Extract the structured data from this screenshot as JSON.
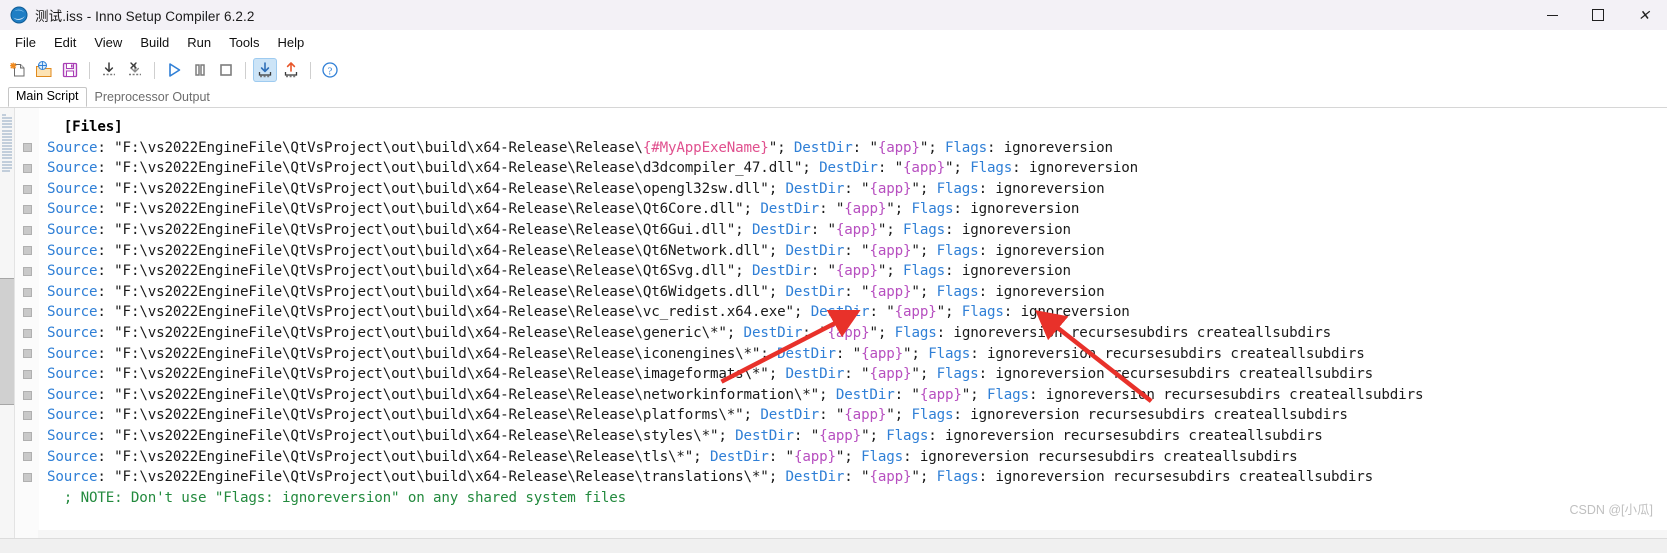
{
  "window": {
    "title": "测试.iss - Inno Setup Compiler 6.2.2",
    "app_icon": "inno-setup-icon",
    "controls": {
      "minimize": "—",
      "maximize": "☐",
      "close": "✕"
    }
  },
  "menubar": {
    "items": [
      {
        "label": "File"
      },
      {
        "label": "Edit"
      },
      {
        "label": "View"
      },
      {
        "label": "Build"
      },
      {
        "label": "Run"
      },
      {
        "label": "Tools"
      },
      {
        "label": "Help"
      }
    ]
  },
  "toolbar": {
    "buttons": [
      {
        "name": "new-file-icon",
        "tip": "New"
      },
      {
        "name": "open-file-icon",
        "tip": "Open"
      },
      {
        "name": "save-file-icon",
        "tip": "Save"
      },
      {
        "name": "compile-icon",
        "tip": "Compile"
      },
      {
        "name": "stop-compile-icon",
        "tip": "Stop Compile"
      },
      {
        "name": "run-icon",
        "tip": "Run"
      },
      {
        "name": "pause-icon",
        "tip": "Pause"
      },
      {
        "name": "terminate-icon",
        "tip": "Terminate"
      },
      {
        "name": "import-icon",
        "tip": "Target Setup File"
      },
      {
        "name": "export-icon",
        "tip": "Open Output Folder"
      },
      {
        "name": "help-icon",
        "tip": "Help"
      }
    ]
  },
  "tabs": [
    {
      "label": "Main Script",
      "selected": true
    },
    {
      "label": "Preprocessor Output",
      "selected": false
    }
  ],
  "editor": {
    "colors": {
      "keyword": "#2f7fd6",
      "constant": "#b74fc0",
      "preprocessor": "#e0508e",
      "comment": "#238a3e",
      "text": "#1a1a1a",
      "background": "#ffffff"
    },
    "section_header": "[Files]",
    "lines": [
      {
        "type": "section",
        "text": "[Files]"
      },
      {
        "type": "source",
        "key": "Source",
        "path": "\"F:\\vs2022EngineFile\\QtVsProject\\out\\build\\x64-Release\\Release\\",
        "pre": "{#MyAppExeName}",
        "path_end": "\";",
        "dest_key": "DestDir",
        "dest": "\"{app}\";",
        "flags_key": "Flags",
        "flags": "ignoreversion"
      },
      {
        "type": "source",
        "key": "Source",
        "path": "\"F:\\vs2022EngineFile\\QtVsProject\\out\\build\\x64-Release\\Release\\d3dcompiler_47.dll\";",
        "dest_key": "DestDir",
        "dest": "\"{app}\";",
        "flags_key": "Flags",
        "flags": "ignoreversion"
      },
      {
        "type": "source",
        "key": "Source",
        "path": "\"F:\\vs2022EngineFile\\QtVsProject\\out\\build\\x64-Release\\Release\\opengl32sw.dll\";",
        "dest_key": "DestDir",
        "dest": "\"{app}\";",
        "flags_key": "Flags",
        "flags": "ignoreversion"
      },
      {
        "type": "source",
        "key": "Source",
        "path": "\"F:\\vs2022EngineFile\\QtVsProject\\out\\build\\x64-Release\\Release\\Qt6Core.dll\";",
        "dest_key": "DestDir",
        "dest": "\"{app}\";",
        "flags_key": "Flags",
        "flags": "ignoreversion"
      },
      {
        "type": "source",
        "key": "Source",
        "path": "\"F:\\vs2022EngineFile\\QtVsProject\\out\\build\\x64-Release\\Release\\Qt6Gui.dll\";",
        "dest_key": "DestDir",
        "dest": "\"{app}\";",
        "flags_key": "Flags",
        "flags": "ignoreversion"
      },
      {
        "type": "source",
        "key": "Source",
        "path": "\"F:\\vs2022EngineFile\\QtVsProject\\out\\build\\x64-Release\\Release\\Qt6Network.dll\";",
        "dest_key": "DestDir",
        "dest": "\"{app}\";",
        "flags_key": "Flags",
        "flags": "ignoreversion"
      },
      {
        "type": "source",
        "key": "Source",
        "path": "\"F:\\vs2022EngineFile\\QtVsProject\\out\\build\\x64-Release\\Release\\Qt6Svg.dll\";",
        "dest_key": "DestDir",
        "dest": "\"{app}\";",
        "flags_key": "Flags",
        "flags": "ignoreversion"
      },
      {
        "type": "source",
        "key": "Source",
        "path": "\"F:\\vs2022EngineFile\\QtVsProject\\out\\build\\x64-Release\\Release\\Qt6Widgets.dll\";",
        "dest_key": "DestDir",
        "dest": "\"{app}\";",
        "flags_key": "Flags",
        "flags": "ignoreversion"
      },
      {
        "type": "source",
        "key": "Source",
        "path": "\"F:\\vs2022EngineFile\\QtVsProject\\out\\build\\x64-Release\\Release\\vc_redist.x64.exe\";",
        "dest_key": "DestDir",
        "dest": "\"{app}\";",
        "flags_key": "Flags",
        "flags": "ignoreversion"
      },
      {
        "type": "source",
        "key": "Source",
        "path": "\"F:\\vs2022EngineFile\\QtVsProject\\out\\build\\x64-Release\\Release\\generic\\*\";",
        "dest_key": "DestDir",
        "dest": "\"{app}\";",
        "flags_key": "Flags",
        "flags": "ignoreversion recursesubdirs createallsubdirs"
      },
      {
        "type": "source",
        "key": "Source",
        "path": "\"F:\\vs2022EngineFile\\QtVsProject\\out\\build\\x64-Release\\Release\\iconengines\\*\";",
        "dest_key": "DestDir",
        "dest": "\"{app}\";",
        "flags_key": "Flags",
        "flags": "ignoreversion recursesubdirs createallsubdirs"
      },
      {
        "type": "source",
        "key": "Source",
        "path": "\"F:\\vs2022EngineFile\\QtVsProject\\out\\build\\x64-Release\\Release\\imageformats\\*\";",
        "dest_key": "DestDir",
        "dest": "\"{app}\";",
        "flags_key": "Flags",
        "flags": "ignoreversion recursesubdirs createallsubdirs"
      },
      {
        "type": "source",
        "key": "Source",
        "path": "\"F:\\vs2022EngineFile\\QtVsProject\\out\\build\\x64-Release\\Release\\networkinformation\\*\";",
        "dest_key": "DestDir",
        "dest": "\"{app}\";",
        "flags_key": "Flags",
        "flags": "ignoreversion recursesubdirs createallsubdirs"
      },
      {
        "type": "source",
        "key": "Source",
        "path": "\"F:\\vs2022EngineFile\\QtVsProject\\out\\build\\x64-Release\\Release\\platforms\\*\";",
        "dest_key": "DestDir",
        "dest": "\"{app}\";",
        "flags_key": "Flags",
        "flags": "ignoreversion recursesubdirs createallsubdirs"
      },
      {
        "type": "source",
        "key": "Source",
        "path": "\"F:\\vs2022EngineFile\\QtVsProject\\out\\build\\x64-Release\\Release\\styles\\*\";",
        "dest_key": "DestDir",
        "dest": "\"{app}\";",
        "flags_key": "Flags",
        "flags": "ignoreversion recursesubdirs createallsubdirs"
      },
      {
        "type": "source",
        "key": "Source",
        "path": "\"F:\\vs2022EngineFile\\QtVsProject\\out\\build\\x64-Release\\Release\\tls\\*\";",
        "dest_key": "DestDir",
        "dest": "\"{app}\";",
        "flags_key": "Flags",
        "flags": "ignoreversion recursesubdirs createallsubdirs"
      },
      {
        "type": "source",
        "key": "Source",
        "path": "\"F:\\vs2022EngineFile\\QtVsProject\\out\\build\\x64-Release\\Release\\translations\\*\";",
        "dest_key": "DestDir",
        "dest": "\"{app}\";",
        "flags_key": "Flags",
        "flags": "ignoreversion recursesubdirs createallsubdirs"
      },
      {
        "type": "comment",
        "text": "; NOTE: Don't use \"Flags: ignoreversion\" on any shared system files"
      }
    ]
  },
  "annotations": {
    "arrow_color": "#e8312a",
    "arrows": [
      {
        "name": "arrow-to-generic-wildcard"
      },
      {
        "name": "arrow-to-destdir-app"
      }
    ]
  },
  "watermark": "CSDN @[小瓜]"
}
